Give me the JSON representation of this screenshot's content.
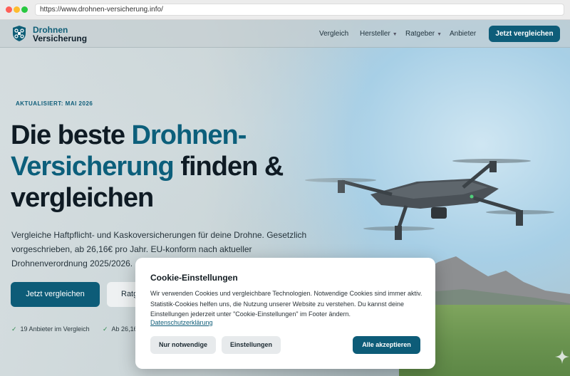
{
  "browser": {
    "url": "https://www.drohnen-versicherung.info/"
  },
  "header": {
    "logo": {
      "line1": "Drohnen",
      "line2": "Versicherung"
    },
    "nav": [
      {
        "label": "Vergleich",
        "dropdown": false
      },
      {
        "label": "Hersteller",
        "dropdown": true
      },
      {
        "label": "Ratgeber",
        "dropdown": true
      },
      {
        "label": "Anbieter",
        "dropdown": false
      }
    ],
    "cta_label": "Jetzt vergleichen"
  },
  "hero": {
    "badge": "AKTUALISIERT: MAI 2026",
    "headline": {
      "part1": "Die beste ",
      "accent1": "Drohnen-",
      "accent2": "Versicherung",
      "part2": " finden &",
      "part3": "vergleichen"
    },
    "subtext": "Vergleiche Haftpflicht- und Kaskoversicherungen für deine Drohne. Gesetzlich vorgeschrieben, ab 26,16€ pro Jahr. EU-konform nach aktueller Drohnenverordnung 2025/2026.",
    "primary_button": "Jetzt vergleichen",
    "secondary_button": "Ratg",
    "trust_items": [
      "19 Anbieter im Vergleich",
      "Ab 26,16"
    ]
  },
  "cookie_banner": {
    "title": "Cookie-Einstellungen",
    "text": "Wir verwenden Cookies und vergleichbare Technologien. Notwendige Cookies sind immer aktiv. Statistik-Cookies helfen uns, die Nutzung unserer Website zu verstehen. Du kannst deine Einstellungen jederzeit unter \"Cookie-Einstellungen\" im Footer ändern.",
    "privacy_link": "Datenschutzerklärung",
    "button_necessary": "Nur notwendige",
    "button_settings": "Einstellungen",
    "button_accept": "Alle akzeptieren"
  },
  "icons": {
    "logo": "drone-shield-icon",
    "check": "check-icon",
    "caret": "chevron-down-icon",
    "sparkle": "sparkle-icon"
  },
  "colors": {
    "brand": "#0e5d79",
    "heading": "#0f1b24",
    "check": "#2f8a4e"
  }
}
